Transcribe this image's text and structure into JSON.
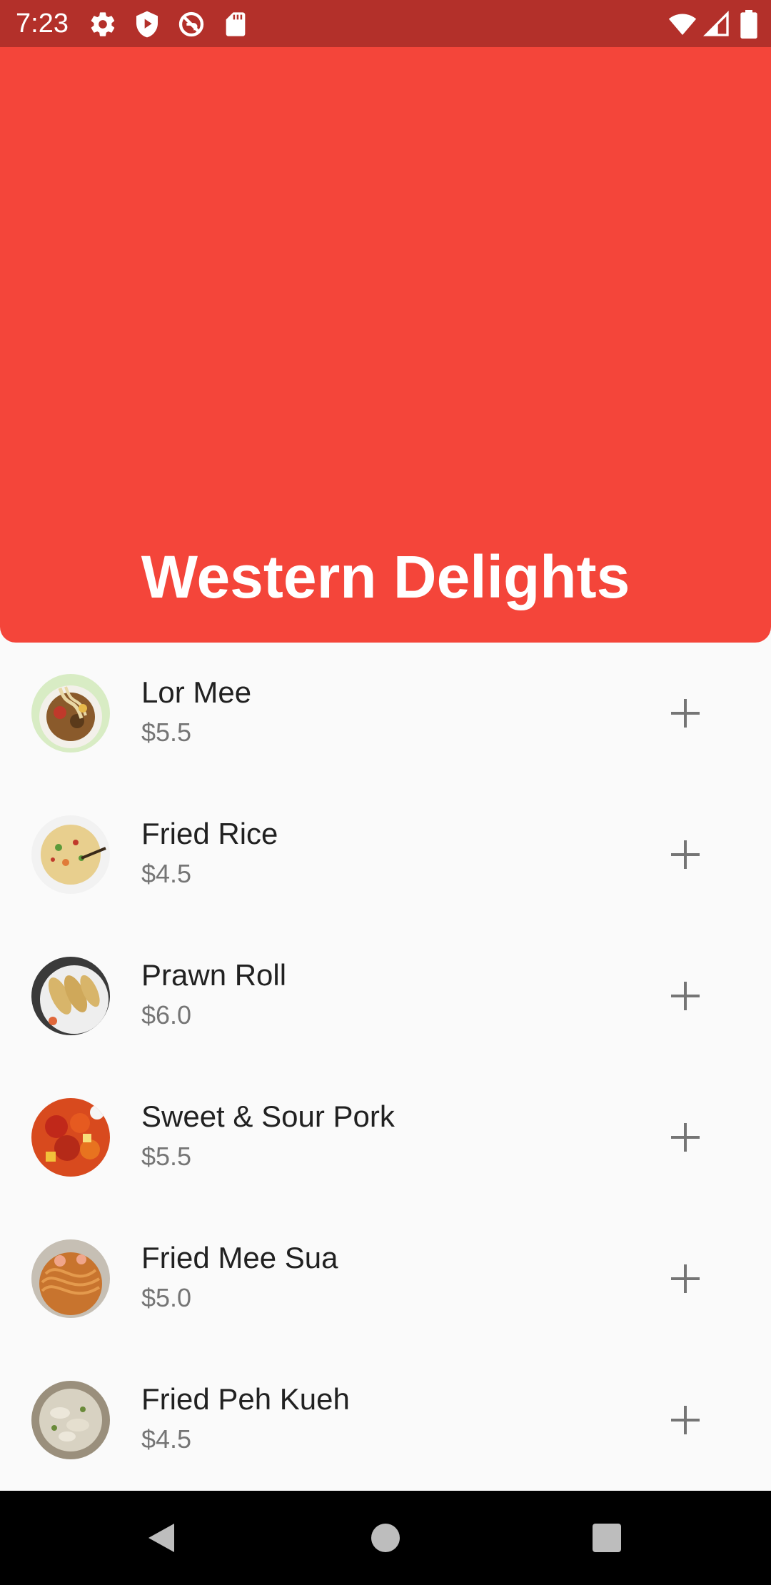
{
  "status_bar": {
    "time": "7:23",
    "left_icons": [
      "gear-icon",
      "shield-play-icon",
      "no-disturb-icon",
      "sd-card-icon"
    ],
    "right_icons": [
      "wifi-icon",
      "cell-signal-icon",
      "battery-icon"
    ]
  },
  "header": {
    "title": "Western Delights",
    "background_color": "#f4453a"
  },
  "menu": {
    "items": [
      {
        "name": "Lor Mee",
        "price": "$5.5",
        "icon": "lor-mee-thumbnail"
      },
      {
        "name": "Fried Rice",
        "price": "$4.5",
        "icon": "fried-rice-thumbnail"
      },
      {
        "name": "Prawn Roll",
        "price": "$6.0",
        "icon": "prawn-roll-thumbnail"
      },
      {
        "name": "Sweet & Sour Pork",
        "price": "$5.5",
        "icon": "sweet-sour-pork-thumbnail"
      },
      {
        "name": "Fried Mee Sua",
        "price": "$5.0",
        "icon": "fried-mee-sua-thumbnail"
      },
      {
        "name": "Fried Peh Kueh",
        "price": "$4.5",
        "icon": "fried-peh-kueh-thumbnail"
      }
    ],
    "add_icon": "plus-icon"
  },
  "nav_bar": {
    "buttons": [
      "back-triangle-icon",
      "home-circle-icon",
      "recents-square-icon"
    ]
  },
  "colors": {
    "status_bar": "#b3302a",
    "header": "#f4453a",
    "background": "#fafafa",
    "item_name": "#212121",
    "item_price": "#757575",
    "plus": "#757575"
  }
}
